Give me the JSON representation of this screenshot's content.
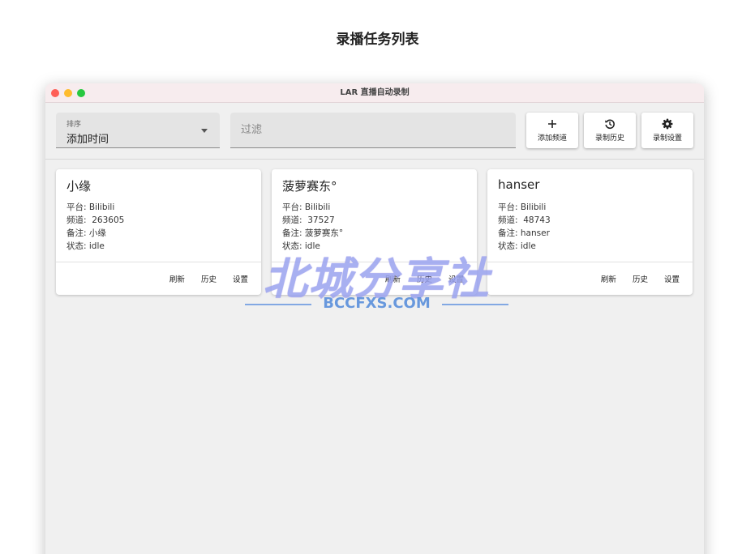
{
  "page_title": "录播任务列表",
  "window": {
    "title": "LAR 直播自动录制"
  },
  "toolbar": {
    "sort": {
      "label": "排序",
      "value": "添加时间"
    },
    "filter": {
      "placeholder": "过滤",
      "value": ""
    },
    "buttons": {
      "add": {
        "label": "添加频道",
        "icon": "plus-icon"
      },
      "history": {
        "label": "录制历史",
        "icon": "history-icon"
      },
      "settings": {
        "label": "录制设置",
        "icon": "gear-icon"
      }
    }
  },
  "labels": {
    "platform": "平台:",
    "channel": "频道:",
    "note": "备注:",
    "status": "状态:"
  },
  "actions": {
    "refresh": "刷新",
    "history": "历史",
    "settings": "设置"
  },
  "cards": [
    {
      "name": "小缘",
      "platform": "Bilibili",
      "channel": "263605",
      "note": "小缘",
      "status": "idle"
    },
    {
      "name": "菠萝赛东°",
      "platform": "Bilibili",
      "channel": "37527",
      "note": "菠萝赛东°",
      "status": "idle"
    },
    {
      "name": "hanser",
      "platform": "Bilibili",
      "channel": "48743",
      "note": "hanser",
      "status": "idle"
    }
  ],
  "watermark": {
    "title": "北城分享社",
    "subtitle": "BCCFXS.COM"
  },
  "colors": {
    "window_bg": "#f0f0f0",
    "titlebar_bg": "#f7ecee",
    "watermark_purple": "#9aa3ef",
    "watermark_blue": "#5a8fdb"
  }
}
